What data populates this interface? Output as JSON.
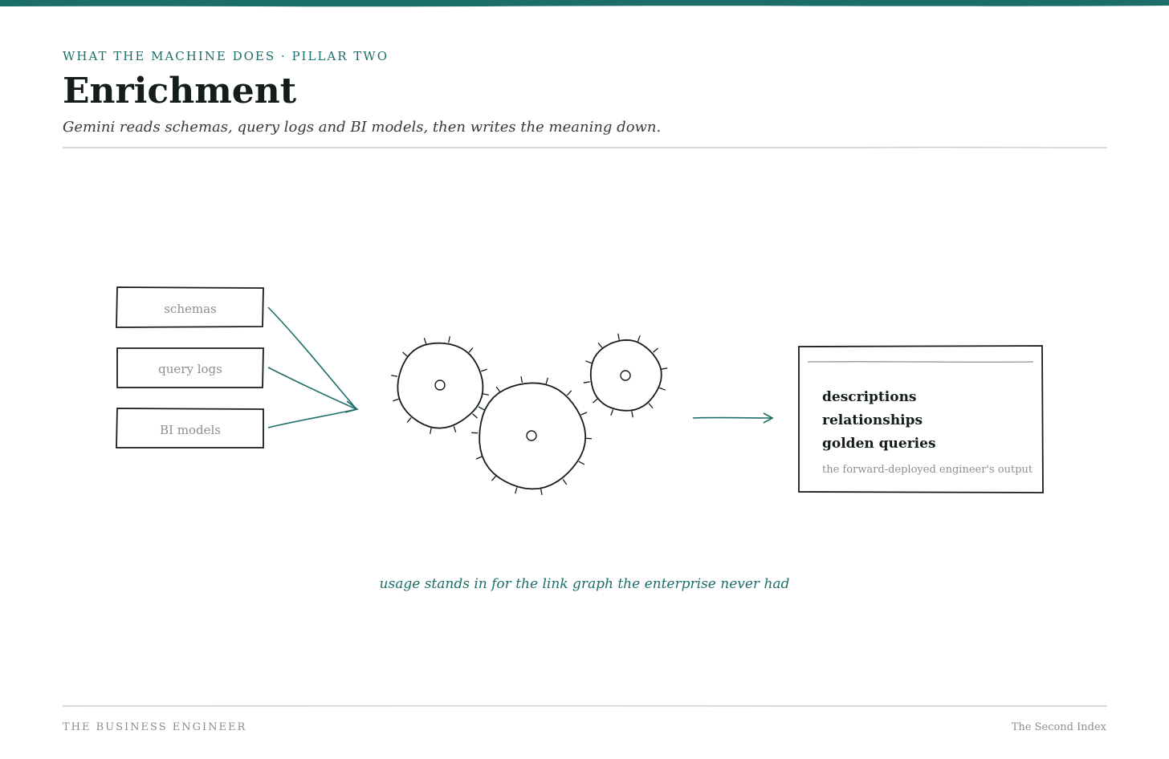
{
  "header": {
    "eyebrow": "WHAT THE MACHINE DOES · PILLAR TWO",
    "title": "Enrichment",
    "subtitle": "Gemini reads schemas, query logs and BI models, then writes the meaning down."
  },
  "inputs": [
    {
      "label": "schemas"
    },
    {
      "label": "query logs"
    },
    {
      "label": "BI models"
    }
  ],
  "output": {
    "items": [
      "descriptions",
      "relationships",
      "golden queries"
    ],
    "caption": "the forward-deployed engineer's output"
  },
  "caption": "usage stands in for the link graph the enterprise never had",
  "footer": {
    "left": "THE BUSINESS ENGINEER",
    "right": "The Second Index"
  },
  "colors": {
    "accent": "#1c6e68",
    "ink": "#141c1c",
    "muted": "#8a9090",
    "rule": "#cfcbc2"
  }
}
